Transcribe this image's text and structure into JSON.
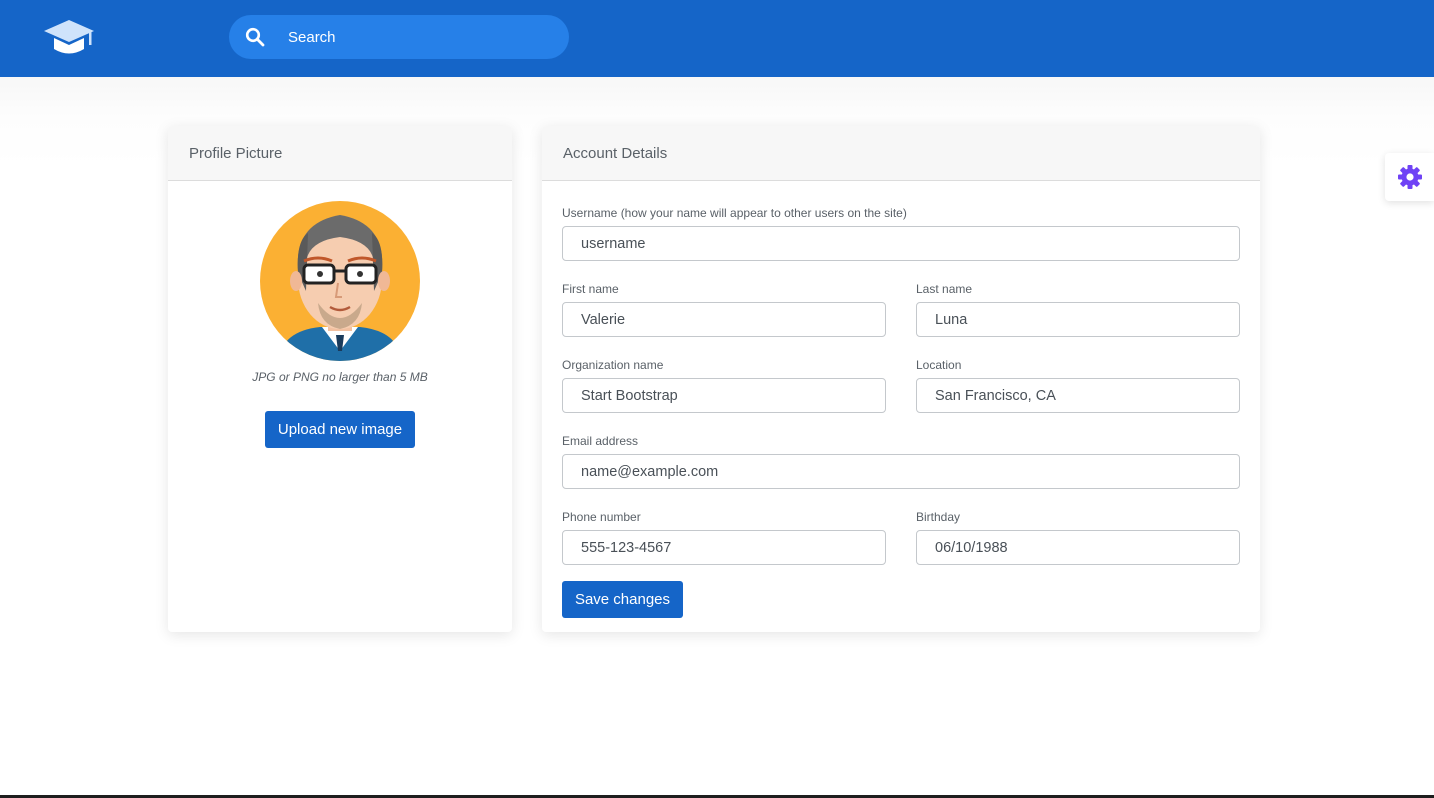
{
  "header": {
    "logo": "graduation-cap-icon",
    "search": {
      "placeholder": "Search",
      "icon": "search-icon"
    },
    "color": "#1565c8"
  },
  "profile_card": {
    "title": "Profile Picture",
    "avatar": "avatar-illustration",
    "hint": "JPG or PNG no larger than 5 MB",
    "upload_label": "Upload new image"
  },
  "account_card": {
    "title": "Account Details",
    "fields": {
      "username": {
        "label": "Username (how your name will appear to other users on the site)",
        "placeholder": "username",
        "value": ""
      },
      "first_name": {
        "label": "First name",
        "value": "Valerie"
      },
      "last_name": {
        "label": "Last name",
        "value": "Luna"
      },
      "organization": {
        "label": "Organization name",
        "value": "Start Bootstrap"
      },
      "location": {
        "label": "Location",
        "value": "San Francisco, CA"
      },
      "email": {
        "label": "Email address",
        "placeholder": "name@example.com",
        "value": ""
      },
      "phone": {
        "label": "Phone number",
        "value": "555-123-4567"
      },
      "birthday": {
        "label": "Birthday",
        "value": "06/10/1988"
      }
    },
    "save_label": "Save changes"
  },
  "settings_tab": {
    "icon": "gear-icon",
    "color": "#6f42f5"
  }
}
